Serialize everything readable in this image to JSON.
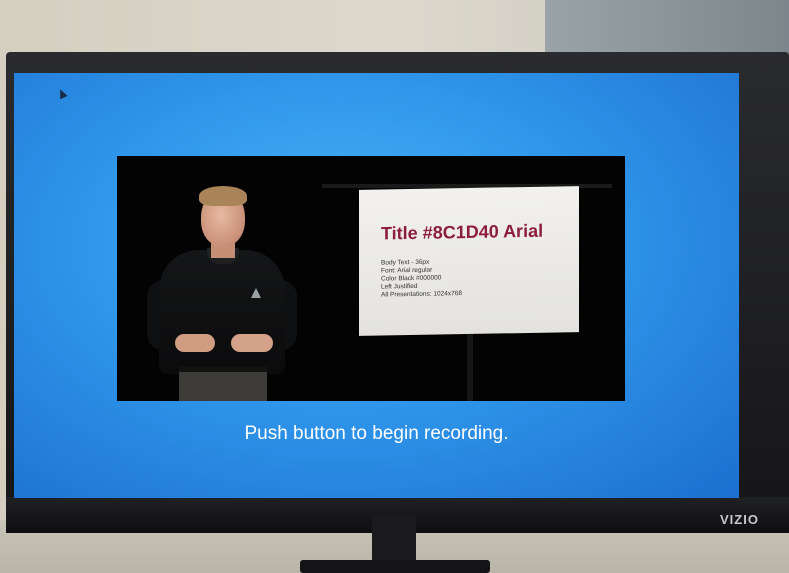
{
  "tv": {
    "brand": "VIZIO"
  },
  "slide": {
    "title": "Title #8C1D40 Arial",
    "body_lines": [
      "Body Text - 36px",
      "Font: Arial regular",
      "Color Black #000000",
      "Left Justified",
      "All Presentations: 1024x768"
    ]
  },
  "caption": "Push button to begin recording.",
  "colors": {
    "screen_blue": "#2f96ea",
    "slide_title": "#8C1D40"
  }
}
